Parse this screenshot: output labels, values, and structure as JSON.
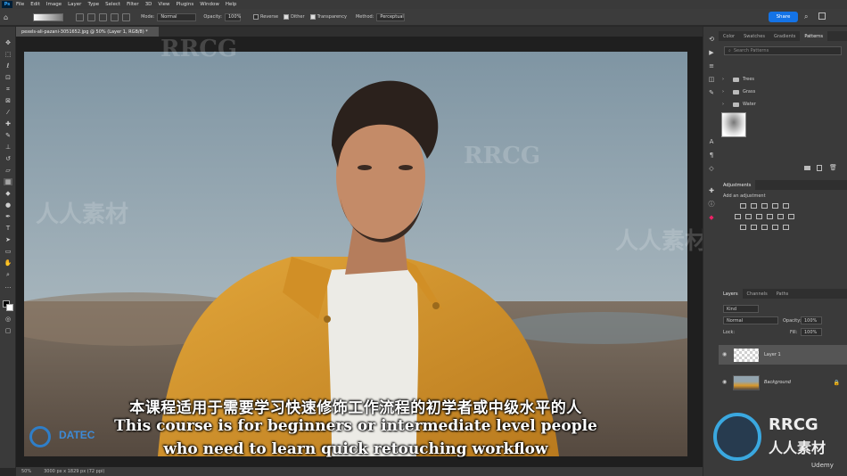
{
  "menubar": {
    "app_icon": "Ps",
    "items": [
      "File",
      "Edit",
      "Image",
      "Layer",
      "Type",
      "Select",
      "Filter",
      "3D",
      "View",
      "Plugins",
      "Window",
      "Help"
    ]
  },
  "options": {
    "mode_label": "Mode:",
    "mode_value": "Normal",
    "opacity_label": "Opacity:",
    "opacity_value": "100%",
    "reverse_label": "Reverse",
    "dither_label": "Dither",
    "transparency_label": "Transparency",
    "method_label": "Method:",
    "method_value": "Perceptual",
    "share_label": "Share"
  },
  "document": {
    "tab_title": "pexels-ali-pazani-3051652.jpg @ 50% (Layer 1, RGB/8) *",
    "status_zoom": "50%",
    "status_size": "3000 px x 1829 px (72 ppi)"
  },
  "panels": {
    "top_tabs": [
      "Color",
      "Swatches",
      "Gradients",
      "Patterns"
    ],
    "active_top_tab": "Patterns",
    "search_placeholder": "Search Patterns",
    "pattern_groups": [
      "Trees",
      "Grass",
      "Water"
    ],
    "adjustments_tab": "Adjustments",
    "add_adjustment": "Add an adjustment",
    "layer_tabs": [
      "Layers",
      "Channels",
      "Paths"
    ],
    "kind_value": "Kind",
    "blend_mode": "Normal",
    "opacity_label": "Opacity:",
    "opacity_value": "100%",
    "lock_label": "Lock:",
    "fill_label": "Fill:",
    "fill_value": "100%",
    "layers": [
      {
        "name": "Layer 1"
      },
      {
        "name": "Background"
      }
    ]
  },
  "subtitles": {
    "line_cn": "本课程适用于需要学习快速修饰工作流程的初学者或中级水平的人",
    "line_en1": "This course is for beginners or intermediate level people",
    "line_en2": "who need to learn quick retouching workflow"
  },
  "branding": {
    "datec": "DATEC",
    "rrcg": "RRCG",
    "rrcg_cn": "人人素材",
    "udemy": "Udemy"
  },
  "colors": {
    "share_blue": "#1473e6",
    "panel_bg": "#3a3a3a",
    "jacket": "#d89a2e"
  }
}
